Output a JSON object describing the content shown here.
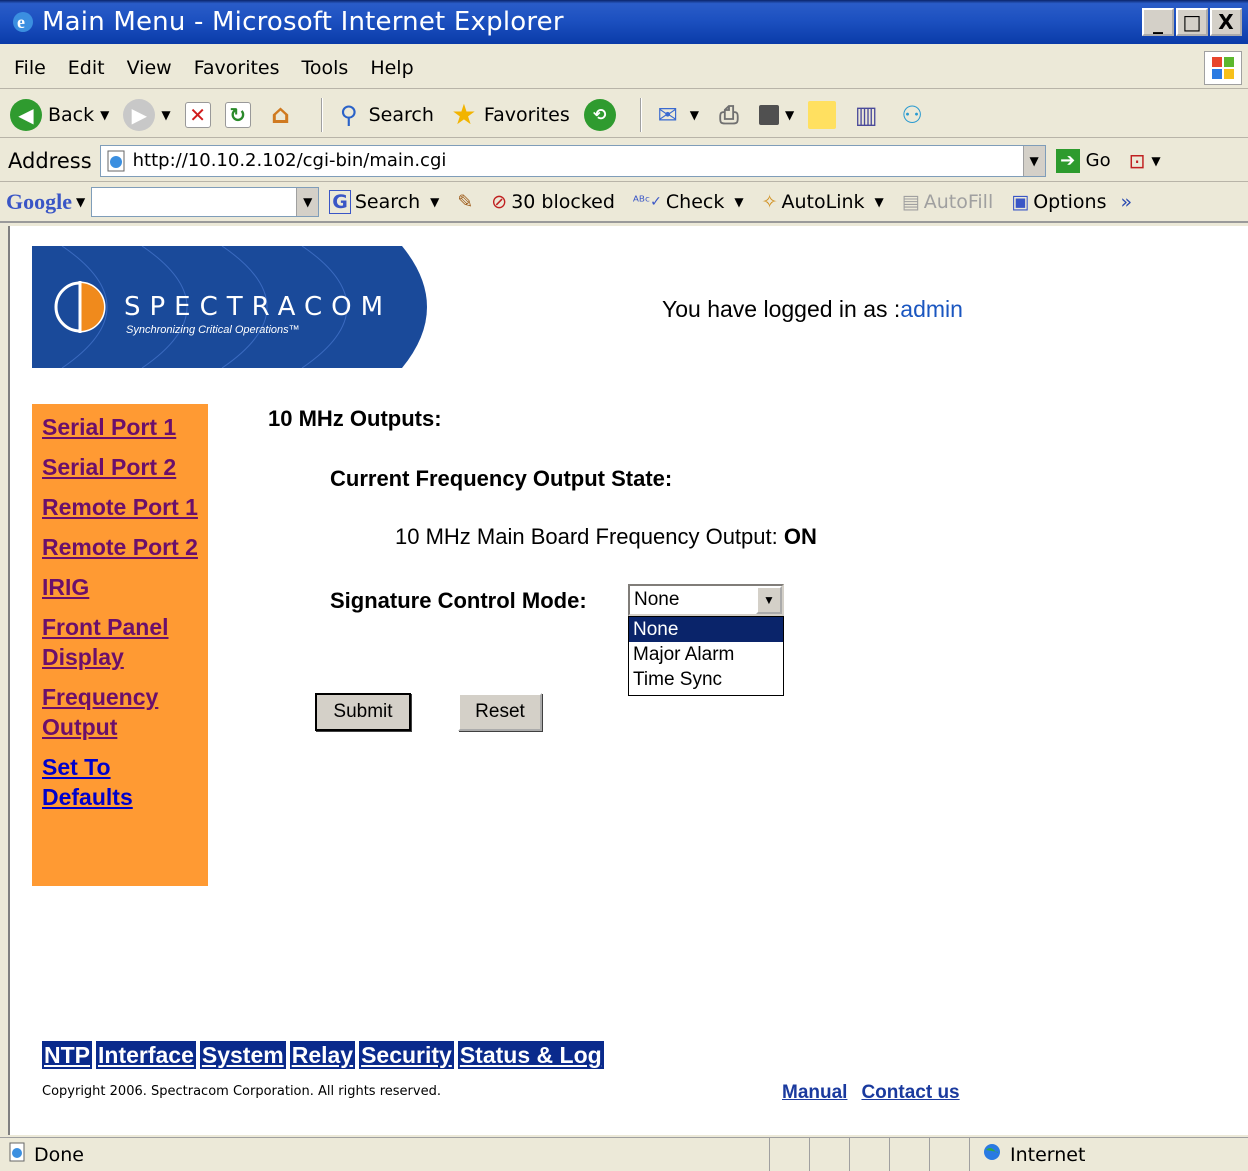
{
  "window": {
    "title": "Main Menu - Microsoft Internet Explorer",
    "buttons": [
      "_",
      "□",
      "X"
    ]
  },
  "menubar": {
    "items": [
      {
        "label": "File",
        "accel": "F"
      },
      {
        "label": "Edit",
        "accel": "E"
      },
      {
        "label": "View",
        "accel": "V"
      },
      {
        "label": "Favorites",
        "accel": "a"
      },
      {
        "label": "Tools",
        "accel": "T"
      },
      {
        "label": "Help",
        "accel": "H"
      }
    ]
  },
  "toolbar": {
    "back_label": "Back",
    "search_label": "Search",
    "favorites_label": "Favorites"
  },
  "address": {
    "label": "Address",
    "url": "http://10.10.2.102/cgi-bin/main.cgi",
    "go_label": "Go"
  },
  "googlebar": {
    "logo": "Google",
    "search_label": "Search",
    "blocked_label": "30 blocked",
    "check_label": "Check",
    "autolink_label": "AutoLink",
    "autofill_label": "AutoFill",
    "options_label": "Options"
  },
  "page": {
    "logo_text": "SPECTRACOM",
    "logo_tagline": "Synchronizing Critical Operations™",
    "logged_prefix": "You have logged in as :",
    "logged_user": "admin",
    "sidebar": [
      {
        "label": "Serial Port 1",
        "visited": true
      },
      {
        "label": "Serial Port 2",
        "visited": true
      },
      {
        "label": "Remote Port 1",
        "visited": true
      },
      {
        "label": "Remote Port 2",
        "visited": true
      },
      {
        "label": "IRIG",
        "visited": true
      },
      {
        "label": "Front Panel Display",
        "visited": true
      },
      {
        "label": "Frequency Output",
        "visited": true
      },
      {
        "label": "Set To Defaults",
        "visited": false
      }
    ],
    "section_title": "10 MHz Outputs:",
    "sub_title": "Current Frequency Output State:",
    "freq_label": "10 MHz Main Board Frequency Output:",
    "freq_value": "ON",
    "sig_label": "Signature Control Mode:",
    "select_value": "None",
    "select_options": [
      "None",
      "Major Alarm",
      "Time Sync"
    ],
    "submit_label": "Submit",
    "reset_label": "Reset",
    "bottom_nav": [
      "NTP",
      "Interface",
      "System",
      "Relay",
      "Security",
      "Status & Log"
    ],
    "copyright": "Copyright 2006. Spectracom Corporation. All rights reserved.",
    "manual_label": "Manual",
    "contact_label": "Contact us"
  },
  "status": {
    "text": "Done",
    "zone": "Internet"
  }
}
